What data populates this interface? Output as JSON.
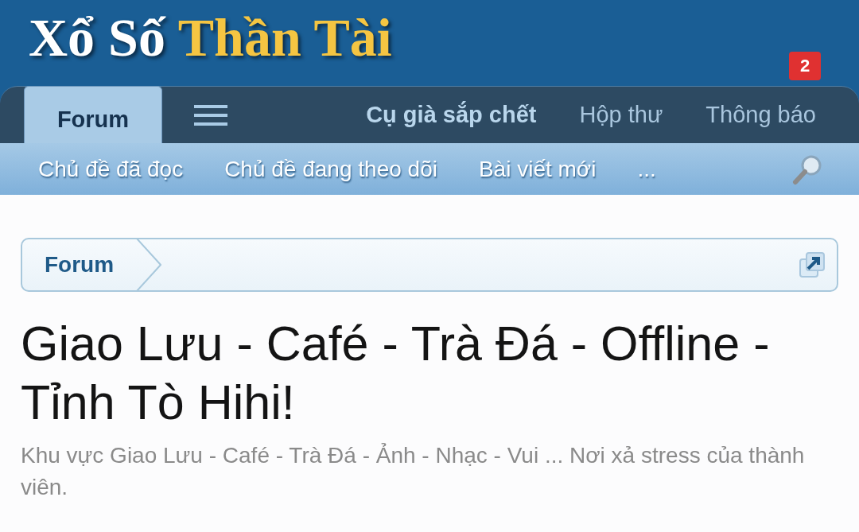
{
  "logo": {
    "part_1": "Xổ Số",
    "part_2": "Thần Tài"
  },
  "tabs": [
    {
      "label": "Forum",
      "selected": true
    }
  ],
  "nav_links": [
    {
      "label": "Cụ già sắp chết",
      "kind": "user"
    },
    {
      "label": "Hộp thư",
      "kind": "link"
    },
    {
      "label": "Thông báo",
      "kind": "link",
      "badge": "2"
    }
  ],
  "sub_nav": [
    "Chủ đề đã đọc",
    "Chủ đề đang theo dõi",
    "Bài viết mới",
    "..."
  ],
  "breadcrumb": [
    "Forum"
  ],
  "title": "Giao Lưu - Café - Trà Đá - Offline - Tỉnh Tò Hihi!",
  "description": "Khu vực Giao Lưu - Café - Trà Đá - Ảnh - Nhạc - Vui ... Nơi xả stress của thành viên."
}
